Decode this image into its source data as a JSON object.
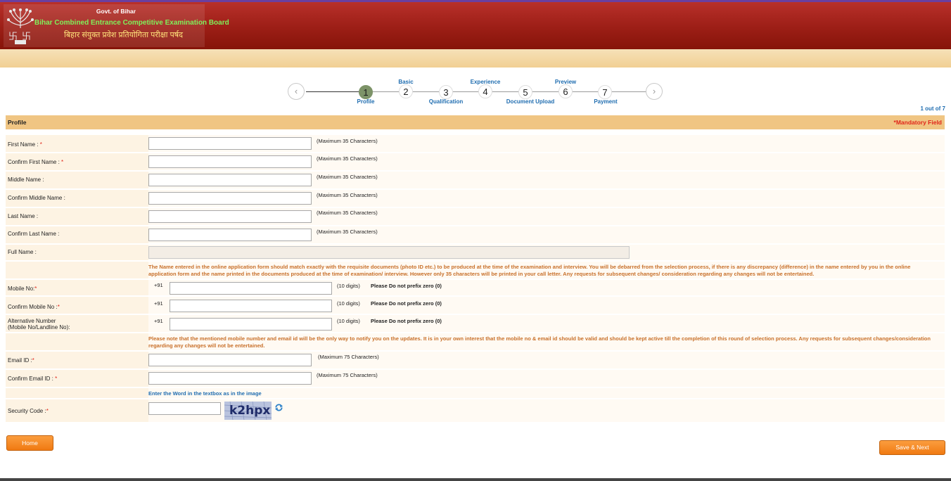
{
  "header": {
    "govt": "Govt. of Bihar",
    "board_en": "Bihar Combined Entrance Competitive Examination Board",
    "board_hi": "बिहार संयुक्त प्रवेश प्रतियोगिता परीक्षा पर्षद",
    "colors": {
      "header": "#9c1e16",
      "band": "#f1cf93",
      "accent": "#f07a12"
    }
  },
  "wizard": {
    "prev_icon": "chevron-left-icon",
    "next_icon": "chevron-right-icon",
    "prev_glyph": "‹",
    "next_glyph": "›",
    "active_step": 1,
    "steps": [
      {
        "num": "1",
        "label": "Profile"
      },
      {
        "num": "2",
        "label": "Basic"
      },
      {
        "num": "3",
        "label": "Qualification"
      },
      {
        "num": "4",
        "label": "Experience"
      },
      {
        "num": "5",
        "label": "Document Upload"
      },
      {
        "num": "6",
        "label": "Preview"
      },
      {
        "num": "7",
        "label": "Payment"
      }
    ],
    "page_of": "1 out of 7"
  },
  "section": {
    "title": "Profile",
    "mandatory": "*Mandatory Field"
  },
  "form": {
    "star": "*",
    "first_name": {
      "label": "First Name : ",
      "hint": "(Maximum 35 Characters)",
      "value": ""
    },
    "confirm_first_name": {
      "label": "Confirm First Name : ",
      "hint": "(Maximum 35 Characters)",
      "value": ""
    },
    "middle_name": {
      "label": "Middle Name :",
      "hint": "(Maximum 35 Characters)",
      "value": ""
    },
    "confirm_middle_name": {
      "label": "Confirm Middle Name :",
      "hint": "(Maximum 35 Characters)",
      "value": ""
    },
    "last_name": {
      "label": "Last Name :",
      "hint": "(Maximum 35 Characters)",
      "value": ""
    },
    "confirm_last_name": {
      "label": "Confirm Last Name :",
      "hint": "(Maximum 35 Characters)",
      "value": ""
    },
    "full_name": {
      "label": "Full Name :",
      "value": ""
    },
    "name_note": "The Name entered in the online application form should match exactly with the requisite documents (photo ID etc.) to be produced at the time of the examination and interview. You will be debarred from the selection process, if there is any discrepancy (difference) in the name entered by you in the online application form and the name printed in the documents produced at the time of examination/ interview. However only 35 characters will be printed in your call letter. Any requests for subsequent changes/ consideration regarding any changes will not be entertained.",
    "mobile": {
      "label": "Mobile No:",
      "prefix": "+91",
      "hint": "(10 digits)",
      "warn": "Please Do not prefix zero (0)",
      "value": ""
    },
    "confirm_mobile": {
      "label": "Confirm Mobile No :",
      "prefix": "+91",
      "hint": "(10 digits)",
      "warn": "Please Do not prefix zero (0)",
      "value": ""
    },
    "alt_number": {
      "label_line1": "Alternative Number",
      "label_line2": "(Mobile No/Landline No):",
      "prefix": "+91",
      "hint": "(10 digits)",
      "warn": "Please Do not prefix zero (0)",
      "value": ""
    },
    "mobile_note": "Please note that the mentioned mobile number and email id will be the only way to notify you on the updates. It is in your own interest that the mobile no & email id should be valid and should be kept active till the completion of this round of selection process. Any requests for subsequent changes/consideration regarding any changes will not be entertained.",
    "email": {
      "label": "Email ID :",
      "hint": "(Maximum 75 Characters)",
      "value": ""
    },
    "confirm_email": {
      "label": "Confirm Email ID : ",
      "hint": "(Maximum 75 Characters)",
      "value": ""
    },
    "captcha_note": "Enter the Word in the textbox as in the image",
    "security": {
      "label": "Security Code :",
      "captcha_text": "k2hpx",
      "value": "",
      "refresh_icon": "refresh-icon"
    }
  },
  "buttons": {
    "home": "Home",
    "save_next": "Save & Next"
  }
}
